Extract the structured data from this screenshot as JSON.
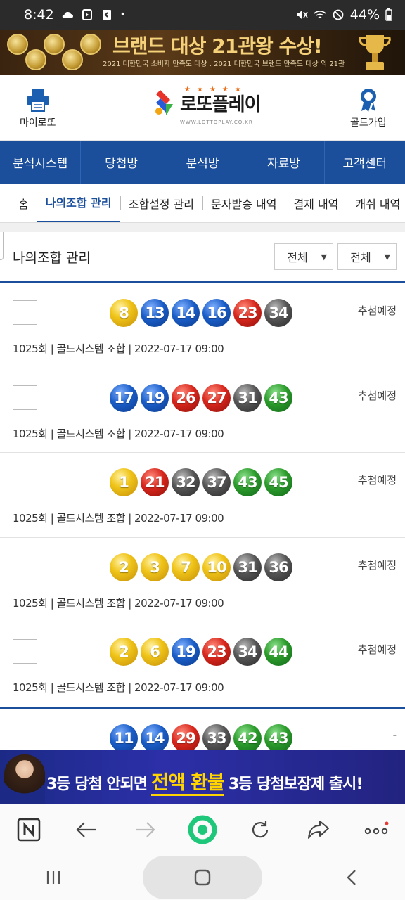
{
  "status_bar": {
    "time": "8:42",
    "battery": "44%"
  },
  "top_banner": {
    "title": "브랜드 대상 21관왕 수상!",
    "subtitle": "2021 대한민국 소비자 만족도 대상 . 2021 대한민국 브랜드 만족도 대상 외 21관"
  },
  "header": {
    "left_button": "마이로또",
    "logo": "로또플레이",
    "logo_url": "WWW.LOTTOPLAY.CO.KR",
    "right_button": "골드가입"
  },
  "main_nav": [
    "분석시스템",
    "당첨방",
    "분석방",
    "자료방",
    "고객센터"
  ],
  "sub_nav": [
    "홈",
    "나의조합 관리",
    "조합설정 관리",
    "문자발송 내역",
    "결제 내역",
    "캐쉬 내역"
  ],
  "page": {
    "title": "나의조합 관리",
    "filter1": "전체",
    "filter2": "전체"
  },
  "rows": [
    {
      "balls": [
        "8",
        "13",
        "14",
        "16",
        "23",
        "34"
      ],
      "status": "추첨예정",
      "meta": "1025회 | 골드시스템 조합 | 2022-07-17 09:00"
    },
    {
      "balls": [
        "17",
        "19",
        "26",
        "27",
        "31",
        "43"
      ],
      "status": "추첨예정",
      "meta": "1025회 | 골드시스템 조합 | 2022-07-17 09:00"
    },
    {
      "balls": [
        "1",
        "21",
        "32",
        "37",
        "43",
        "45"
      ],
      "status": "추첨예정",
      "meta": "1025회 | 골드시스템 조합 | 2022-07-17 09:00"
    },
    {
      "balls": [
        "2",
        "3",
        "7",
        "10",
        "31",
        "36"
      ],
      "status": "추첨예정",
      "meta": "1025회 | 골드시스템 조합 | 2022-07-17 09:00"
    },
    {
      "balls": [
        "2",
        "6",
        "19",
        "23",
        "34",
        "44"
      ],
      "status": "추첨예정",
      "meta": "1025회 | 골드시스템 조합 | 2022-07-17 09:00"
    },
    {
      "balls": [
        "11",
        "14",
        "29",
        "33",
        "42",
        "43"
      ],
      "status": "-",
      "meta": ""
    }
  ],
  "ad": {
    "before": "3등 당첨 안되면",
    "highlight": "전액 환불",
    "after": "3등 당첨보장제 출시!"
  },
  "colors": {
    "nav_blue": "#1b4f9c",
    "ball_yellow": "#f0c419",
    "ball_blue": "#1a5dc7",
    "ball_red": "#d7261c",
    "ball_gray": "#555555",
    "ball_green": "#2a9a2a"
  }
}
